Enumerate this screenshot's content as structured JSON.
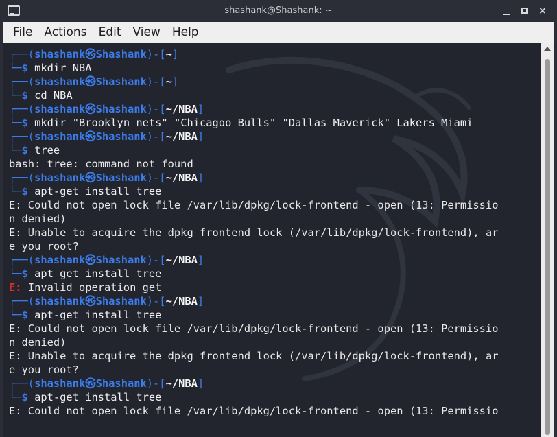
{
  "window": {
    "title": "shashank@Shashank: ~",
    "close_glyph": "×"
  },
  "menu": [
    "File",
    "Actions",
    "Edit",
    "View",
    "Help"
  ],
  "prompt": {
    "user": "shashank",
    "at_symbol": "㉿",
    "host": "Shashank",
    "top_open": "┌──(",
    "top_mid": ")-[",
    "top_close": "]",
    "bottom": "└─",
    "dollar": "$"
  },
  "colors": {
    "background": "#23252e",
    "prompt_blue": "#3b7cea",
    "error_red": "#e02b2b",
    "text": "#e8e8e8"
  },
  "terminal_lines": [
    {
      "type": "prompt_top",
      "dir": "~"
    },
    {
      "type": "prompt_cmd",
      "text": "mkdir NBA"
    },
    {
      "type": "prompt_top",
      "dir": "~"
    },
    {
      "type": "prompt_cmd",
      "text": "cd NBA"
    },
    {
      "type": "prompt_top",
      "dir": "~/NBA"
    },
    {
      "type": "prompt_cmd",
      "text": "mkdir \"Brooklyn nets\" \"Chicagoo Bulls\" \"Dallas Maverick\" Lakers Miami"
    },
    {
      "type": "prompt_top",
      "dir": "~/NBA"
    },
    {
      "type": "prompt_cmd",
      "text": "tree"
    },
    {
      "type": "output",
      "text": "bash: tree: command not found"
    },
    {
      "type": "prompt_top",
      "dir": "~/NBA"
    },
    {
      "type": "prompt_cmd",
      "text": "apt-get install tree"
    },
    {
      "type": "output",
      "text": "E: Could not open lock file /var/lib/dpkg/lock-frontend - open (13: Permissio"
    },
    {
      "type": "output",
      "text": "n denied)"
    },
    {
      "type": "output",
      "text": "E: Unable to acquire the dpkg frontend lock (/var/lib/dpkg/lock-frontend), ar"
    },
    {
      "type": "output",
      "text": "e you root?"
    },
    {
      "type": "prompt_top",
      "dir": "~/NBA"
    },
    {
      "type": "prompt_cmd",
      "text": "apt get install tree"
    },
    {
      "type": "error",
      "label": "E:",
      "text": " Invalid operation get"
    },
    {
      "type": "prompt_top",
      "dir": "~/NBA"
    },
    {
      "type": "prompt_cmd",
      "text": "apt-get install tree"
    },
    {
      "type": "output",
      "text": "E: Could not open lock file /var/lib/dpkg/lock-frontend - open (13: Permissio"
    },
    {
      "type": "output",
      "text": "n denied)"
    },
    {
      "type": "output",
      "text": "E: Unable to acquire the dpkg frontend lock (/var/lib/dpkg/lock-frontend), ar"
    },
    {
      "type": "output",
      "text": "e you root?"
    },
    {
      "type": "prompt_top",
      "dir": "~/NBA"
    },
    {
      "type": "prompt_cmd",
      "text": "apt-get install tree"
    },
    {
      "type": "output",
      "text": "E: Could not open lock file /var/lib/dpkg/lock-frontend - open (13: Permissio"
    }
  ]
}
